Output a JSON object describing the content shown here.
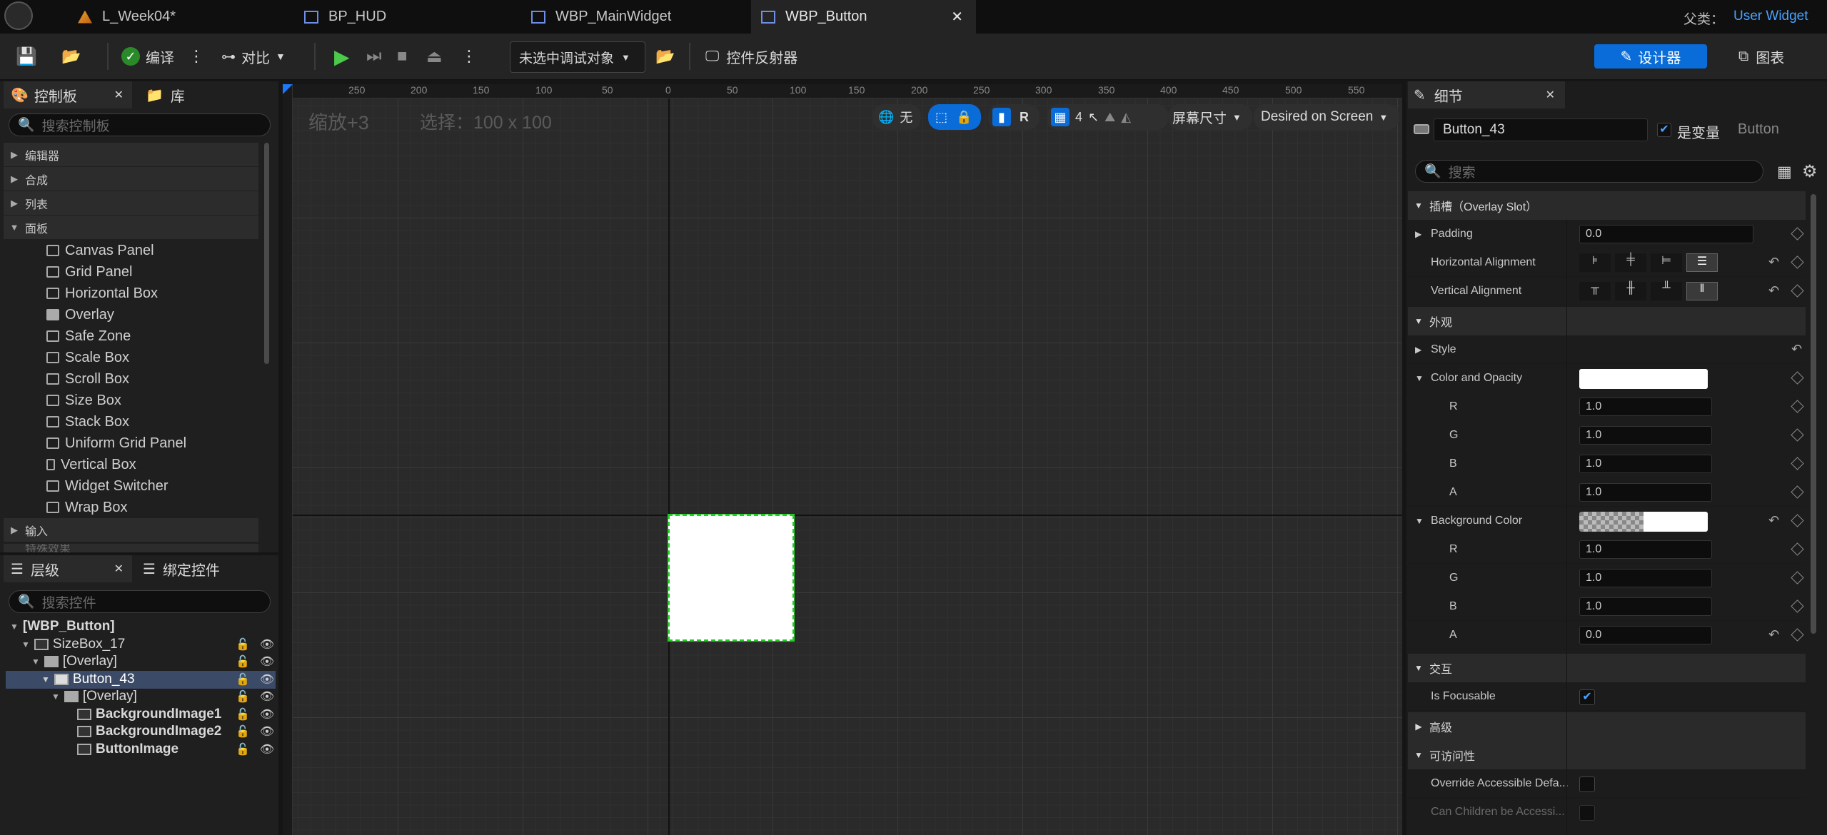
{
  "titlebar": {
    "tabs": [
      "L_Week04*",
      "BP_HUD",
      "WBP_MainWidget",
      "WBP_Button"
    ],
    "parent_label": "父类：",
    "parent_value": "User Widget"
  },
  "toolbar": {
    "compile": "编译",
    "diff": "对比",
    "debug_select": "未选中调试对象",
    "reflector": "控件反射器",
    "designer": "设计器",
    "graph": "图表"
  },
  "palette": {
    "tab": "控制板",
    "library_tab": "库",
    "search_placeholder": "搜索控制板",
    "categories": [
      "编辑器",
      "合成",
      "列表",
      "面板"
    ],
    "items": [
      "Canvas Panel",
      "Grid Panel",
      "Horizontal Box",
      "Overlay",
      "Safe Zone",
      "Scale Box",
      "Scroll Box",
      "Size Box",
      "Stack Box",
      "Uniform Grid Panel",
      "Vertical Box",
      "Widget Switcher",
      "Wrap Box"
    ],
    "cat_input": "输入",
    "cat_partial": "特殊效果"
  },
  "hierarchy": {
    "tab": "层级",
    "bind_tab": "绑定控件",
    "search_placeholder": "搜索控件",
    "rows": [
      "[WBP_Button]",
      "SizeBox_17",
      "[Overlay]",
      "Button_43",
      "[Overlay]",
      "BackgroundImage1",
      "BackgroundImage2",
      "ButtonImage"
    ]
  },
  "canvas": {
    "zoom": "缩放+3",
    "selection": "选择：100 x 100",
    "none": "无",
    "r": "R",
    "grid_num": "4",
    "screen_size": "屏幕尺寸",
    "desired": "Desired on Screen",
    "ruler_top": [
      "250",
      "200",
      "150",
      "100",
      "50",
      "0",
      "50",
      "100",
      "150",
      "200",
      "250",
      "300",
      "350",
      "400",
      "450",
      "500",
      "550"
    ]
  },
  "details": {
    "tab": "细节",
    "name": "Button_43",
    "is_variable": "是变量",
    "type": "Button",
    "search_placeholder": "搜索",
    "sec_slot": "插槽（Overlay Slot）",
    "padding": "Padding",
    "padding_val": "0.0",
    "halign": "Horizontal Alignment",
    "valign": "Vertical Alignment",
    "sec_appearance": "外观",
    "style": "Style",
    "color_opacity": "Color and Opacity",
    "r": "R",
    "g": "G",
    "b": "B",
    "a": "A",
    "c_r": "1.0",
    "c_g": "1.0",
    "c_b": "1.0",
    "c_a": "1.0",
    "bg_color": "Background Color",
    "bg_r": "1.0",
    "bg_g": "1.0",
    "bg_b": "1.0",
    "bg_a": "0.0",
    "sec_interaction": "交互",
    "is_focusable": "Is Focusable",
    "sec_advanced": "高级",
    "sec_access": "可访问性",
    "override_access": "Override Accessible Defa...",
    "children_access": "Can Children be Accessi..."
  },
  "colors": {
    "accent": "#0a6cd8",
    "selection_green": "#22cc22",
    "parent_link": "#4aa3ff"
  }
}
